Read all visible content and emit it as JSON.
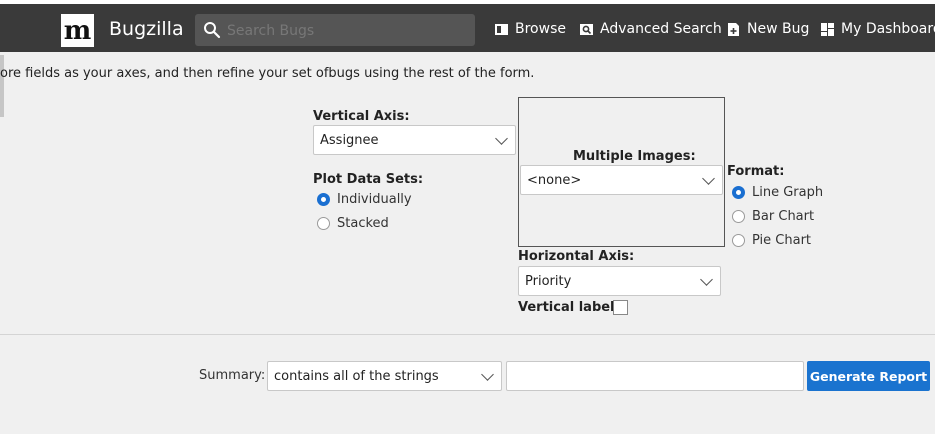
{
  "header": {
    "logo_letter": "m",
    "app_title": "Bugzilla",
    "search_placeholder": "Search Bugs",
    "nav": [
      {
        "label": "Browse",
        "icon": "browse-icon"
      },
      {
        "label": "Advanced Search",
        "icon": "advanced-search-icon"
      },
      {
        "label": "New Bug",
        "icon": "new-bug-icon"
      },
      {
        "label": "My Dashboard",
        "icon": "dashboard-icon"
      }
    ]
  },
  "intro_text": "ore fields as your axes, and then refine your set ofbugs using the rest of the form.",
  "form": {
    "vertical_axis": {
      "label": "Vertical Axis:",
      "value": "Assignee"
    },
    "plot_data_sets": {
      "label": "Plot Data Sets:",
      "options": [
        {
          "label": "Individually",
          "selected": true
        },
        {
          "label": "Stacked",
          "selected": false
        }
      ]
    },
    "multiple_images": {
      "label": "Multiple Images:",
      "value": "<none>"
    },
    "format": {
      "label": "Format:",
      "options": [
        {
          "label": "Line Graph",
          "selected": true
        },
        {
          "label": "Bar Chart",
          "selected": false
        },
        {
          "label": "Pie Chart",
          "selected": false
        }
      ]
    },
    "horizontal_axis": {
      "label": "Horizontal Axis:",
      "value": "Priority"
    },
    "vertical_labels": {
      "label": "Vertical labels:",
      "checked": false
    }
  },
  "summary": {
    "label": "Summary:",
    "operator": "contains all of the strings",
    "value": "",
    "button_label": "Generate Report"
  },
  "colors": {
    "accent": "#1a73cf",
    "header_bg": "#3a3a3a"
  }
}
